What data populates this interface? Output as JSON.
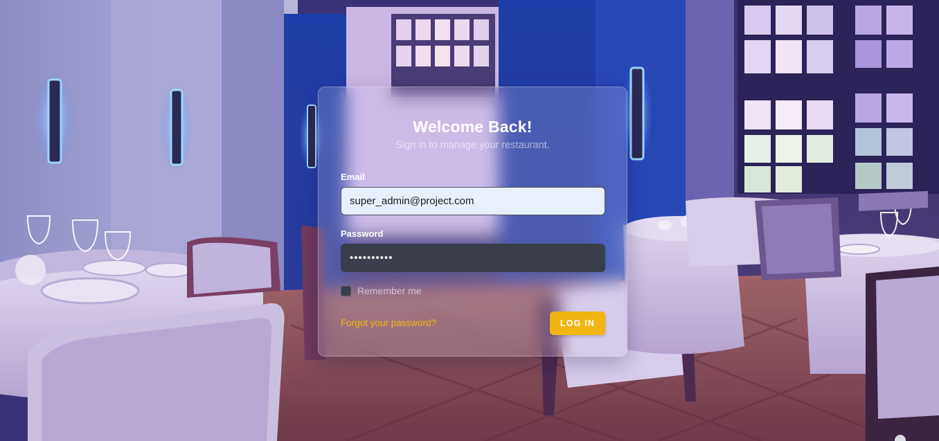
{
  "colors": {
    "accent": "#f0b511",
    "link": "#f2b705",
    "title": "#ffffff",
    "email_field_bg": "#e8f0fe",
    "password_field_bg": "#3a3d4a"
  },
  "login": {
    "title": "Welcome Back!",
    "subtitle": "Sign in to manage your restaurant.",
    "email_label": "Email",
    "email_value": "super_admin@project.com",
    "password_label": "Password",
    "password_value": "••••••••••",
    "remember_label": "Remember me",
    "remember_checked": false,
    "forgot_link": "Forgot your password?",
    "login_button": "LOG IN"
  },
  "background": {
    "icon": "restaurant-dining-room-illustration"
  }
}
